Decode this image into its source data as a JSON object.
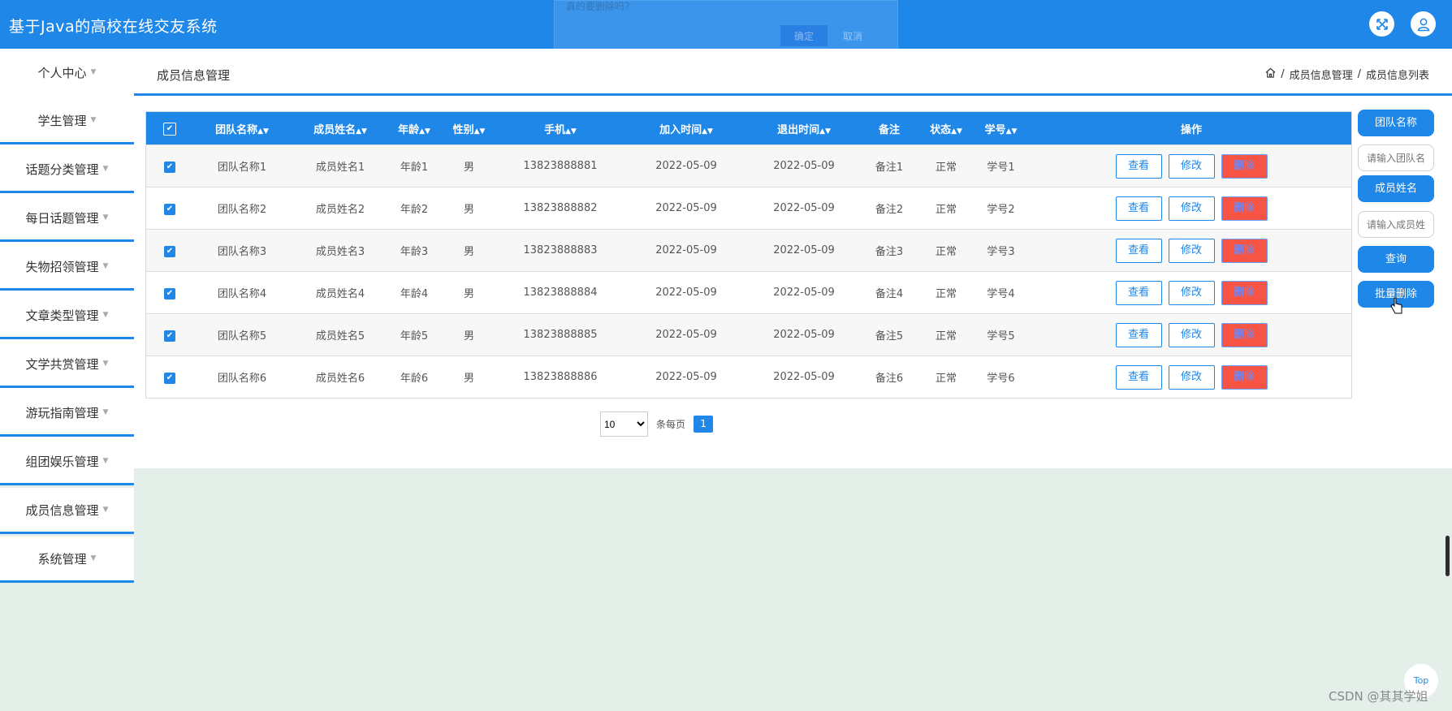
{
  "header": {
    "title": "基于Java的高校在线交友系统"
  },
  "confirm_dialog": {
    "message": "真的要删除吗？",
    "ok_label": "确定",
    "cancel_label": "取消"
  },
  "sidebar": {
    "items": [
      {
        "label": "个人中心"
      },
      {
        "label": "学生管理"
      },
      {
        "label": "话题分类管理"
      },
      {
        "label": "每日话题管理"
      },
      {
        "label": "失物招领管理"
      },
      {
        "label": "文章类型管理"
      },
      {
        "label": "文学共赏管理"
      },
      {
        "label": "游玩指南管理"
      },
      {
        "label": "组团娱乐管理"
      },
      {
        "label": "成员信息管理"
      },
      {
        "label": "系统管理"
      }
    ]
  },
  "page": {
    "title": "成员信息管理"
  },
  "breadcrumb": {
    "items": [
      "成员信息管理",
      "成员信息列表"
    ]
  },
  "table": {
    "columns": [
      "团队名称",
      "成员姓名",
      "年龄",
      "性别",
      "手机",
      "加入时间",
      "退出时间",
      "备注",
      "状态",
      "学号",
      "操作"
    ],
    "rows": [
      [
        "团队名称1",
        "成员姓名1",
        "年龄1",
        "男",
        "13823888881",
        "2022-05-09",
        "2022-05-09",
        "备注1",
        "正常",
        "学号1"
      ],
      [
        "团队名称2",
        "成员姓名2",
        "年龄2",
        "男",
        "13823888882",
        "2022-05-09",
        "2022-05-09",
        "备注2",
        "正常",
        "学号2"
      ],
      [
        "团队名称3",
        "成员姓名3",
        "年龄3",
        "男",
        "13823888883",
        "2022-05-09",
        "2022-05-09",
        "备注3",
        "正常",
        "学号3"
      ],
      [
        "团队名称4",
        "成员姓名4",
        "年龄4",
        "男",
        "13823888884",
        "2022-05-09",
        "2022-05-09",
        "备注4",
        "正常",
        "学号4"
      ],
      [
        "团队名称5",
        "成员姓名5",
        "年龄5",
        "男",
        "13823888885",
        "2022-05-09",
        "2022-05-09",
        "备注5",
        "正常",
        "学号5"
      ],
      [
        "团队名称6",
        "成员姓名6",
        "年龄6",
        "男",
        "13823888886",
        "2022-05-09",
        "2022-05-09",
        "备注6",
        "正常",
        "学号6"
      ]
    ],
    "actions": {
      "view": "查看",
      "edit": "修改",
      "delete": "删除"
    }
  },
  "pagination": {
    "page_size": "10",
    "page_size_label": "条每页",
    "current_page": "1"
  },
  "search_panel": {
    "team_name_label": "团队名称",
    "team_name_placeholder": "请输入团队名称",
    "member_name_label": "成员姓名",
    "member_name_placeholder": "请输入成员姓名",
    "query_label": "查询",
    "batch_delete_label": "批量删除"
  },
  "top_button": "Top",
  "watermark": "CSDN @其其学姐",
  "colors": {
    "primary": "#1e87e8",
    "danger": "#f65546",
    "background": "#e4efea"
  }
}
